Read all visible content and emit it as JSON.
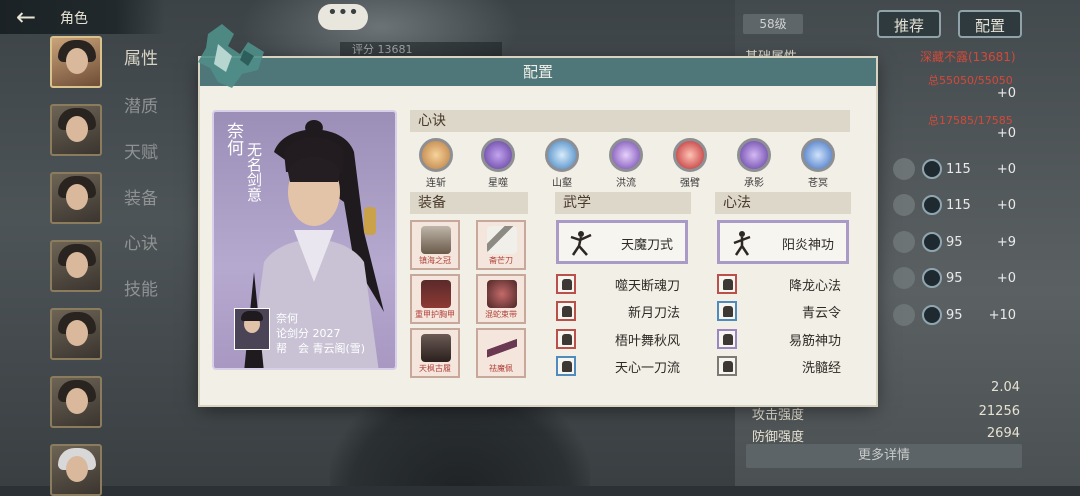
{
  "header": {
    "back_icon": "back-arrow-icon",
    "title": "角色",
    "chat_icon": "chat-bubble-icon",
    "chat_text": "•••"
  },
  "score_bar": "评分 13681",
  "sidebar": {
    "items": [
      {
        "label": "属性",
        "active": true
      },
      {
        "label": "潜质",
        "active": false
      },
      {
        "label": "天赋",
        "active": false
      },
      {
        "label": "装备",
        "active": false
      },
      {
        "label": "心诀",
        "active": false
      },
      {
        "label": "技能",
        "active": false
      }
    ]
  },
  "right_panel": {
    "level": "58级",
    "recommend_btn": "推荐",
    "config_btn": "配置",
    "heading": "基础属性",
    "char_name": "深藏不露(13681)",
    "hp_total": "总55050/55050",
    "hp_plus": "+0",
    "mp_total": "总17585/17585",
    "mp_plus": "+0",
    "stats": [
      {
        "icon": "sword-icon",
        "value": "115",
        "plus": "+0"
      },
      {
        "icon": "fist-icon",
        "value": "115",
        "plus": "+0"
      },
      {
        "icon": "body-icon",
        "value": "95",
        "plus": "+9"
      },
      {
        "icon": "agility-icon",
        "value": "95",
        "plus": "+0"
      },
      {
        "icon": "strength-icon",
        "value": "95",
        "plus": "+10"
      }
    ],
    "rows": [
      {
        "label": "",
        "value": "2.04"
      },
      {
        "label": "攻击强度",
        "value": "21256"
      },
      {
        "label": "防御强度",
        "value": "2694"
      }
    ],
    "more_btn": "更多详情"
  },
  "modal": {
    "title": "配置",
    "card": {
      "name": "奈何",
      "title": "无名剑意",
      "info_name": "奈何",
      "info_score": "论剑分 2027",
      "info_guild": "帮　会 青云阁(雪)"
    },
    "heart_section": "心诀",
    "heart_skills": [
      {
        "label": "连斩",
        "color": "#e6b27a"
      },
      {
        "label": "星噬",
        "color": "#8a5fc0"
      },
      {
        "label": "山壑",
        "color": "#6fa6d9"
      },
      {
        "label": "洪流",
        "color": "#9a6bc9"
      },
      {
        "label": "强臂",
        "color": "#d84a45"
      },
      {
        "label": "承影",
        "color": "#8e5cc6"
      },
      {
        "label": "苍冥",
        "color": "#5b8fd6"
      }
    ],
    "equip_section": "装备",
    "equips": [
      {
        "label": "镇海之冠",
        "color": "#6a5a4a"
      },
      {
        "label": "斋芒刀",
        "color": "#8d8a84"
      },
      {
        "label": "重甲护胸甲",
        "color": "#8d3a34"
      },
      {
        "label": "混蛇束带",
        "color": "#7a3a3a"
      },
      {
        "label": "天枫古履",
        "color": "#3a2e2b"
      },
      {
        "label": "祛魔佩",
        "color": "#6a3850"
      }
    ],
    "martial_section": "武学",
    "martial_main": "天魔刀式",
    "martial_subs": [
      {
        "name": "噬天断魂刀",
        "border": "red"
      },
      {
        "name": "新月刀法",
        "border": "red"
      },
      {
        "name": "梧叶舞秋风",
        "border": "red"
      },
      {
        "name": "天心一刀流",
        "border": "blue"
      }
    ],
    "method_section": "心法",
    "method_main": "阳炎神功",
    "method_subs": [
      {
        "name": "降龙心法",
        "border": "red"
      },
      {
        "name": "青云令",
        "border": "blue"
      },
      {
        "name": "易筋神功",
        "border": "purple"
      },
      {
        "name": "洗髓经",
        "border": "gray"
      }
    ]
  }
}
